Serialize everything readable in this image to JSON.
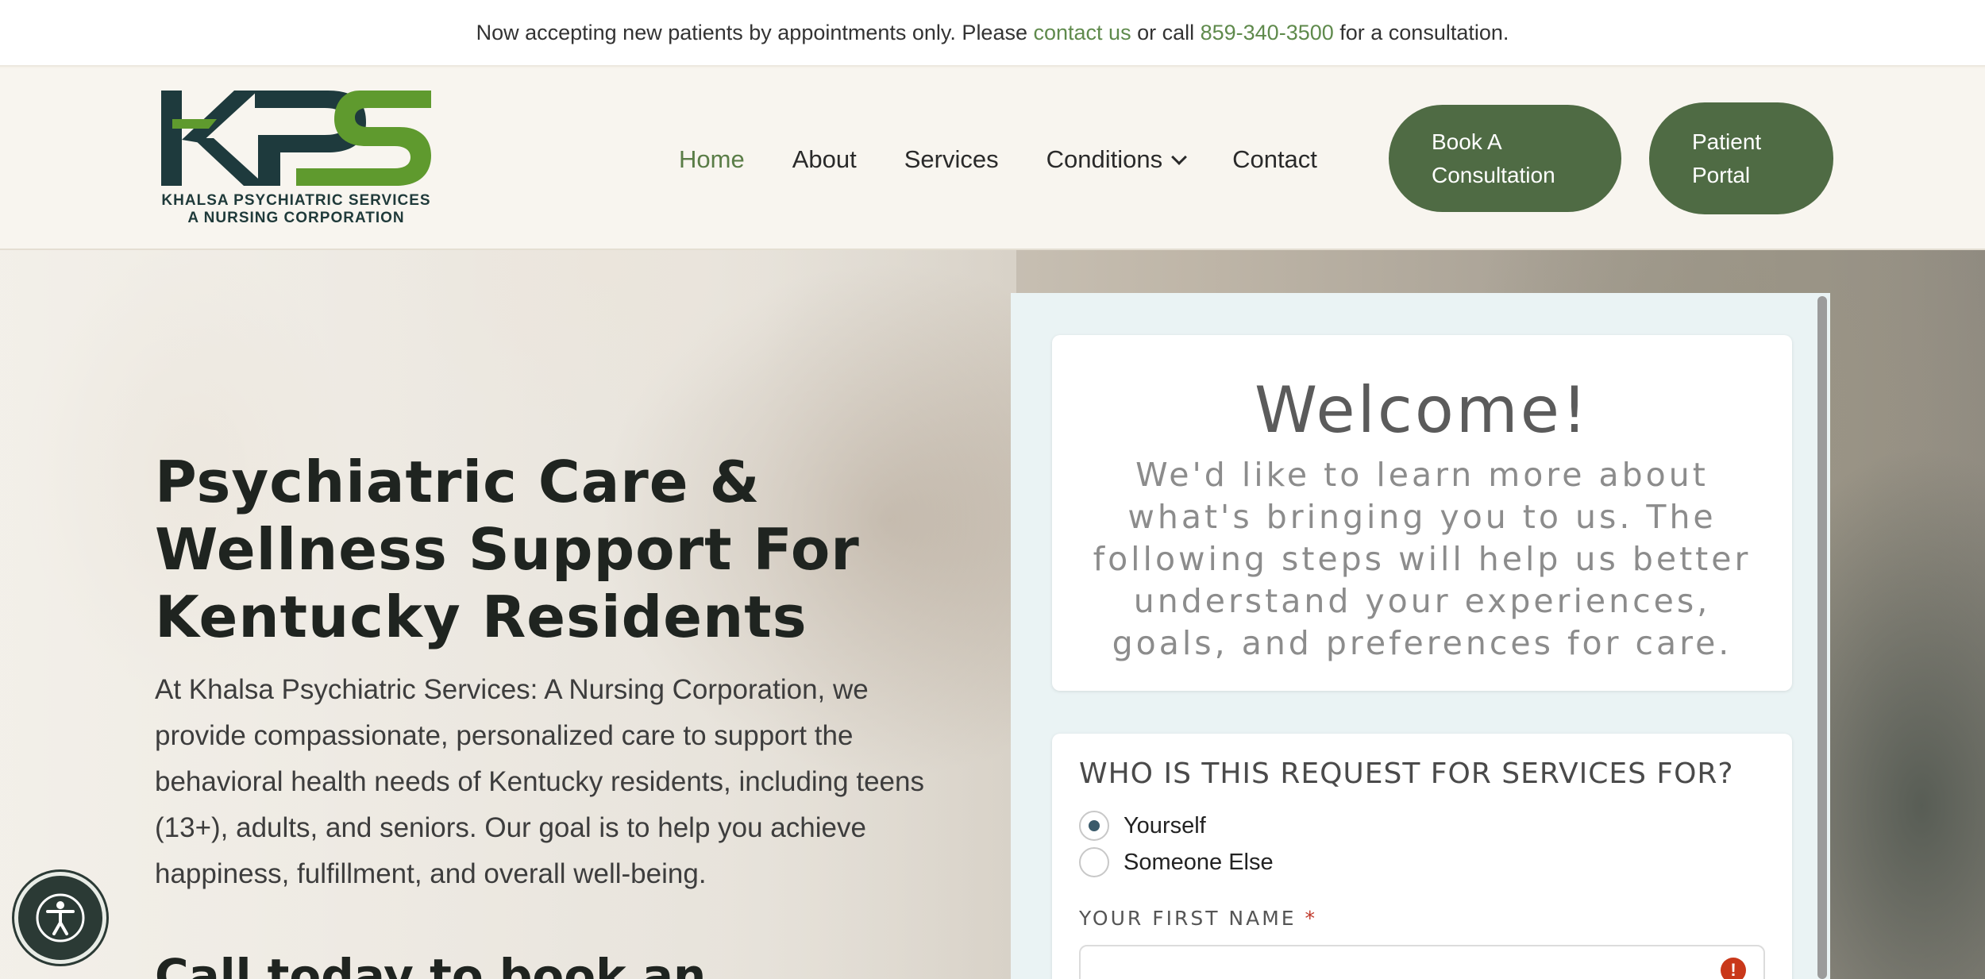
{
  "announcement": {
    "prefix": "Now accepting new patients by appointments only. Please ",
    "contact_link": "contact us",
    "middle": " or call ",
    "phone": "859-340-3500",
    "suffix": " for a consultation."
  },
  "logo": {
    "letters": "KPS",
    "line1": "KHALSA PSYCHIATRIC SERVICES",
    "line2": "A NURSING CORPORATION"
  },
  "nav": {
    "items": [
      {
        "label": "Home",
        "active": true
      },
      {
        "label": "About"
      },
      {
        "label": "Services"
      },
      {
        "label": "Conditions",
        "icon": "chevron-down-icon"
      },
      {
        "label": "Contact"
      }
    ],
    "book_button": "Book A Consultation",
    "portal_button": "Patient Portal"
  },
  "hero": {
    "title": "Psychiatric Care & Wellness Support For Kentucky Residents",
    "body": "At Khalsa Psychiatric Services: A Nursing Corporation, we provide compassionate, personalized care to support the behavioral health needs of Kentucky residents, including teens (13+), adults, and seniors. Our goal is to help you achieve happiness, fulfillment, and overall well-being.",
    "cta_partial": "Call today to book an"
  },
  "form": {
    "welcome_title": "Welcome!",
    "welcome_sub": "We'd like to learn more about what's bringing you to us. The following steps will help us better understand your experiences, goals, and preferences for care.",
    "question": "WHO IS THIS REQUEST FOR SERVICES FOR?",
    "options": [
      {
        "label": "Yourself",
        "checked": true
      },
      {
        "label": "Someone Else",
        "checked": false
      }
    ],
    "first_name_label": "YOUR FIRST NAME",
    "required_marker": "*",
    "first_name_value": "",
    "error_icon": "exclamation-icon"
  },
  "accessibility": {
    "icon": "accessibility-icon"
  },
  "colors": {
    "accent_green": "#4f6b44",
    "link_green": "#5f8a4c",
    "panel_bg": "#eaf3f4",
    "error": "#c9381a"
  }
}
